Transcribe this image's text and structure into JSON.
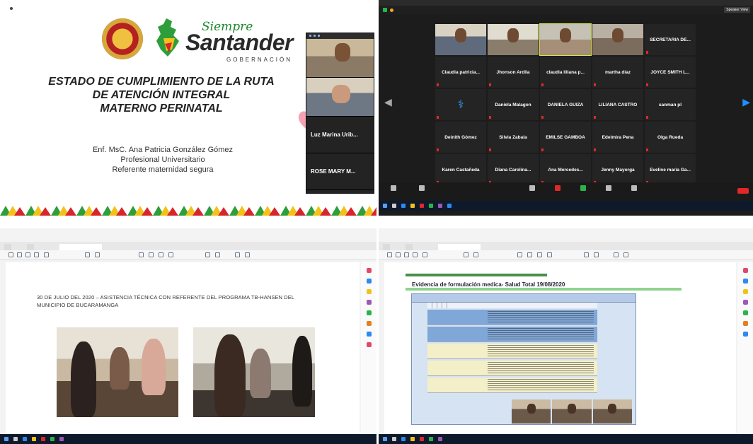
{
  "slide": {
    "brand_top": "Siempre",
    "brand_main": "Santander",
    "brand_sub": "GOBERNACIÓN",
    "title_lines": [
      "ESTADO DE CUMPLIMIENTO DE LA RUTA",
      "DE ATENCIÓN INTEGRAL",
      "MATERNO PERINATAL"
    ],
    "author_lines": [
      "Enf. MsC. Ana Patricia González Gómez",
      "Profesional Universitario",
      "Referente maternidad segura"
    ],
    "zoom_panel": {
      "names": [
        "Luz Marina Urib...",
        "ROSE MARY M..."
      ]
    }
  },
  "gallery": {
    "view_label": "Speaker View",
    "cells": [
      {
        "label": "",
        "camera": true
      },
      {
        "label": "",
        "camera": true
      },
      {
        "label": "",
        "camera": true,
        "active": true
      },
      {
        "label": "",
        "camera": true
      },
      {
        "label": "SECRETARIA DE..."
      },
      {
        "label": "Claudia patricia..."
      },
      {
        "label": "Jhonson Ardila"
      },
      {
        "label": "claudia liliana p..."
      },
      {
        "label": "martha diaz"
      },
      {
        "label": "JOYCE SMITH L..."
      },
      {
        "label": "",
        "logo": true
      },
      {
        "label": "Daniela Malagon"
      },
      {
        "label": "DANIELA GUIZA"
      },
      {
        "label": "LILIANA CASTRO"
      },
      {
        "label": "sanman pl"
      },
      {
        "label": "Deinith Gómez"
      },
      {
        "label": "Silvia Zabala"
      },
      {
        "label": "EMILSE GAMBOA"
      },
      {
        "label": "Edelmira Pena"
      },
      {
        "label": "Olga Rueda"
      },
      {
        "label": "Karen Castañeda"
      },
      {
        "label": "Diana Carolina..."
      },
      {
        "label": "Ana Mercedes..."
      },
      {
        "label": "Jenny Mayorga"
      },
      {
        "label": "Eveline maria Ga..."
      }
    ]
  },
  "pdf_left": {
    "heading": "30 DE JULIO DEL 2020 – ASISTENCIA TÉCNICA CON REFERENTE DEL PROGRAMA TB-HANSEN DEL MUNICIPIO DE BUCARAMANGA"
  },
  "pdf_right": {
    "heading": "Evidencia de formulación medica- Salud Total 19/08/2020"
  },
  "colors": {
    "zoom_bg": "#1c1c1c",
    "santander_green": "#1a8a2a",
    "zoom_end_red": "#e02828",
    "taskbar": "#0e1a2b"
  }
}
